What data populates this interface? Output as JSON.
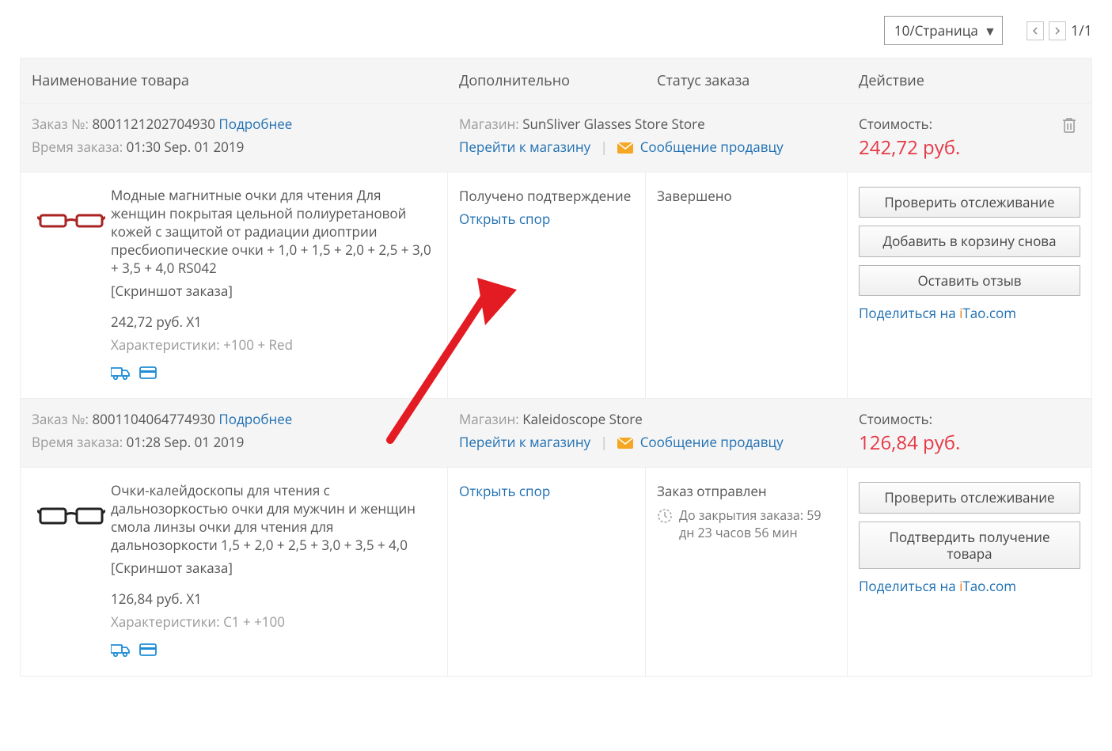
{
  "topbar": {
    "per_page_label": "10/Страница",
    "pager_text": "1/1"
  },
  "columns": {
    "name": "Наименование товара",
    "extra": "Дополнительно",
    "status": "Статус заказа",
    "action": "Действие"
  },
  "labels": {
    "order_no": "Заказ №:",
    "more": "Подробнее",
    "order_time": "Время заказа:",
    "store": "Магазин:",
    "to_store": "Перейти к магазину",
    "msg_seller": "Сообщение продавцу",
    "cost": "Стоимость:",
    "screenshot": "[Скриншот заказа]",
    "attrs_prefix": "Характеристики:",
    "open_dispute": "Открыть спор",
    "confirmed_receipt": "Получено подтверждение",
    "share_prefix": "Поделиться на ",
    "itao_i": "i",
    "itao_rest": "Tao.com",
    "countdown_prefix": "До закрытия заказа:"
  },
  "buttons": {
    "track": "Проверить отслеживание",
    "add_again": "Добавить в корзину снова",
    "leave_review": "Оставить отзыв",
    "confirm_receipt": "Подтвердить получение товара"
  },
  "orders": [
    {
      "id": "8001121202704930",
      "time": "01:30 Sep. 01 2019",
      "store": "SunSliver Glasses Store Store",
      "cost": "242,72 руб.",
      "product_title": "Модные магнитные очки для чтения Для женщин покрытая цельной полиуретановой кожей с защитой от радиации диоптрии пресбиопические очки + 1,0 + 1,5 + 2,0 + 2,5 + 3,0 + 3,5 + 4,0 RS042",
      "price_line": "242,72 руб. X1",
      "attrs": "+100 + Red",
      "status": "Завершено",
      "countdown": ""
    },
    {
      "id": "8001104064774930",
      "time": "01:28 Sep. 01 2019",
      "store": "Kaleidoscope Store",
      "cost": "126,84 руб.",
      "product_title": "Очки-калейдоскопы для чтения с дальнозоркостью очки для мужчин и женщин смола линзы очки для чтения для дальнозоркости 1,5 + 2,0 + 2,5 + 3,0 + 3,5 + 4,0",
      "price_line": "126,84 руб. X1",
      "attrs": "C1 + +100",
      "status": "Заказ отправлен",
      "countdown": "59 дн 23 часов 56 мин"
    }
  ]
}
